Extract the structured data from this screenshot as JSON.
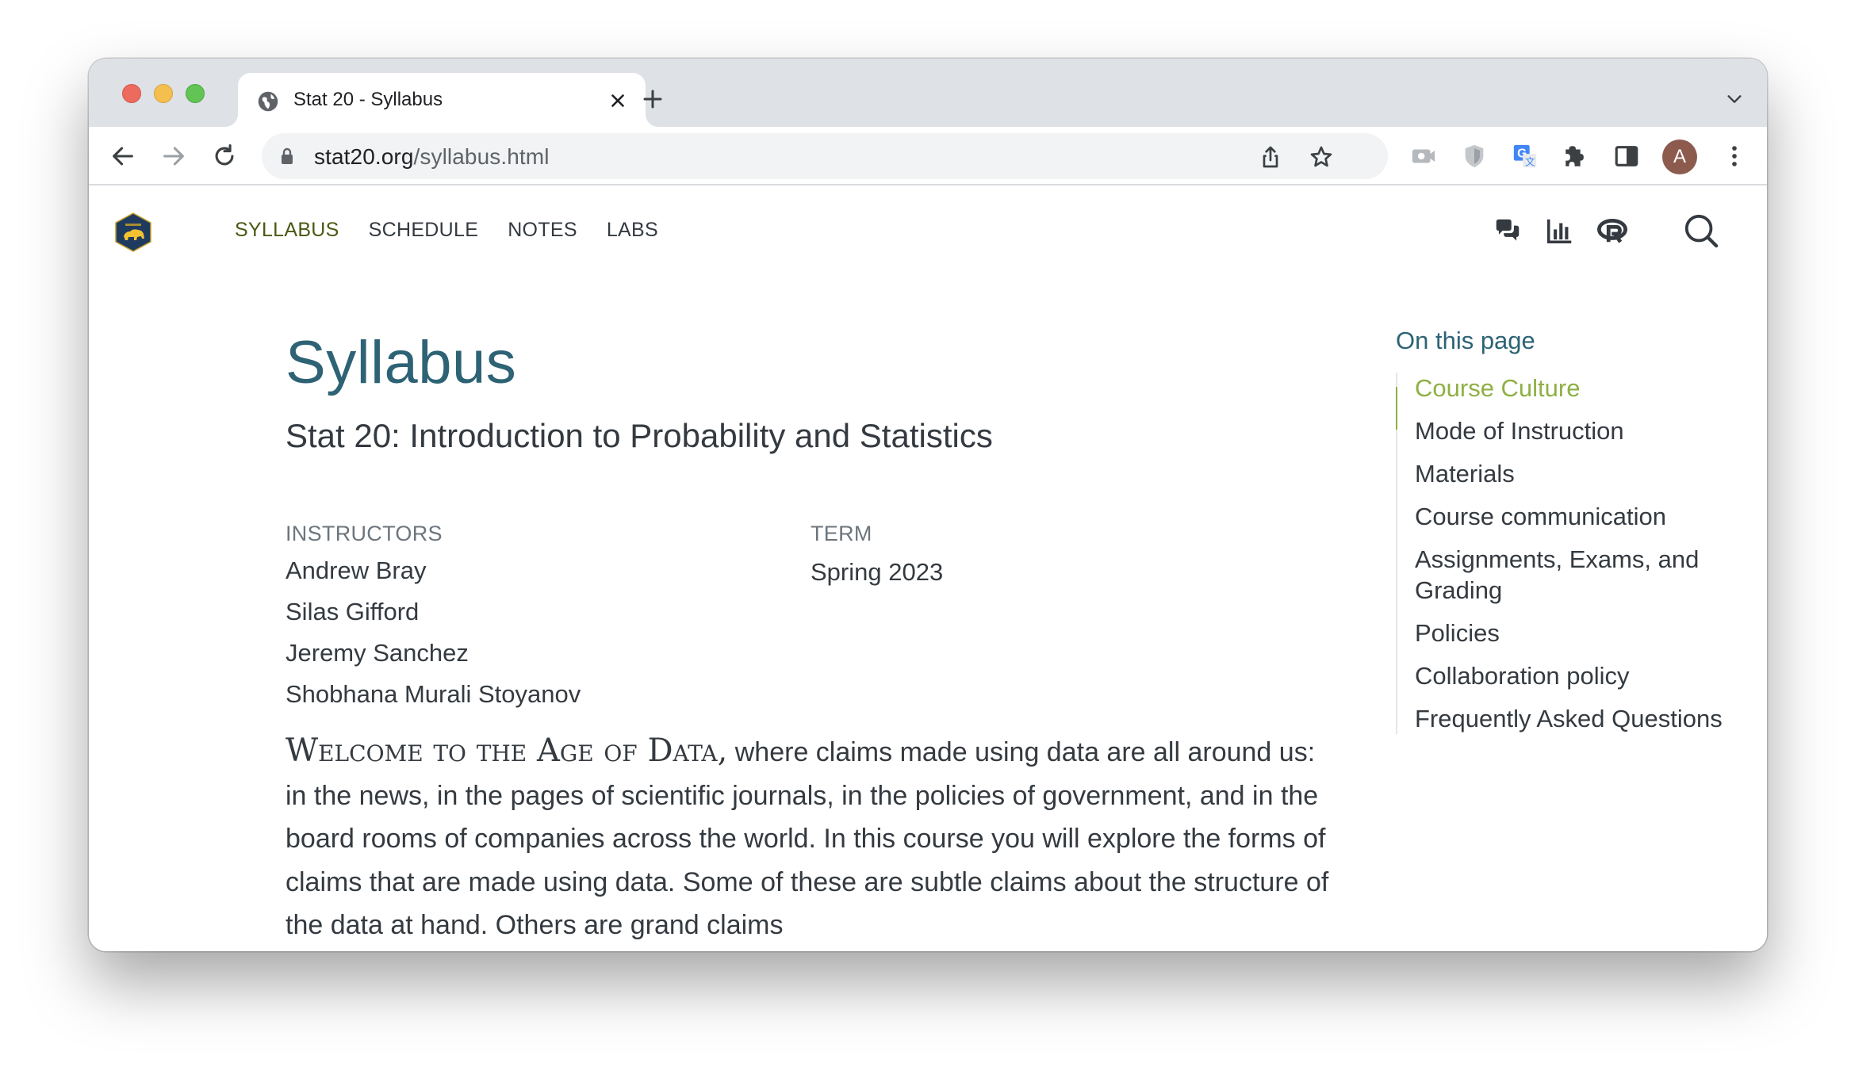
{
  "browser": {
    "tab_title": "Stat 20 - Syllabus",
    "url_host": "stat20.org",
    "url_path": "/syllabus.html",
    "avatar_initial": "A"
  },
  "site_nav": {
    "items": [
      "SYLLABUS",
      "SCHEDULE",
      "NOTES",
      "LABS"
    ],
    "active": "SYLLABUS"
  },
  "main": {
    "title": "Syllabus",
    "subtitle": "Stat 20: Introduction to Probability and Statistics",
    "instructors_heading": "INSTRUCTORS",
    "instructors": [
      "Andrew Bray",
      "Silas Gifford",
      "Jeremy Sanchez",
      "Shobhana Murali Stoyanov"
    ],
    "term_heading": "TERM",
    "term": "Spring 2023",
    "lead_smallcaps": "Welcome to the Age of Data,",
    "lead_rest": " where claims made using data are all around us: in the news, in the pages of scientific journals, in the policies of government, and in the board rooms of companies across the world. In this course you will explore the forms of claims that are made using data. Some of these are subtle claims about the structure of the data at hand. Others are grand claims"
  },
  "toc": {
    "title": "On this page",
    "items": [
      "Course Culture",
      "Mode of Instruction",
      "Materials",
      "Course communication",
      "Assignments, Exams, and Grading",
      "Policies",
      "Collaboration policy",
      "Frequently Asked Questions"
    ],
    "active_index": 0
  },
  "colors": {
    "accent": "#2d6374",
    "active_nav": "#4a5a12",
    "toc_active": "#8eb043"
  }
}
